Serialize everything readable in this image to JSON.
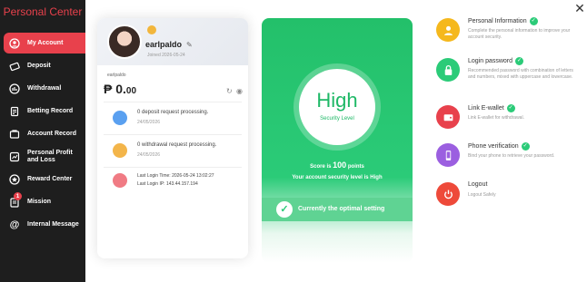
{
  "sidebar": {
    "title": "Personal Center",
    "items": [
      {
        "label": "My Account",
        "icon": "account-icon",
        "active": true
      },
      {
        "label": "Deposit",
        "icon": "deposit-icon"
      },
      {
        "label": "Withdrawal",
        "icon": "withdrawal-icon"
      },
      {
        "label": "Betting Record",
        "icon": "betting-record-icon"
      },
      {
        "label": "Account Record",
        "icon": "account-record-icon"
      },
      {
        "label": "Personal Profit and Loss",
        "icon": "profit-loss-icon"
      },
      {
        "label": "Reward Center",
        "icon": "reward-icon"
      },
      {
        "label": "Mission",
        "icon": "mission-icon",
        "badge": "1"
      },
      {
        "label": "Internal Message",
        "icon": "message-icon"
      }
    ],
    "accent_color": "#e8414c"
  },
  "account": {
    "username": "earlpaldo",
    "joined": "Joined 2026-05-24",
    "sub_username": "earlpaldo",
    "currency": "₱",
    "balance_main": "0.",
    "balance_cents": "00",
    "deposit_status": "0 deposit request processing.",
    "deposit_date": "24/05/2026",
    "withdraw_status": "0 withdrawal request processing.",
    "withdraw_date": "24/05/2026",
    "last_login_time": "Last Login Time:  2026-05-24 13:02:27",
    "last_login_ip": "Last Login IP:  143.44.157.194"
  },
  "security": {
    "level_word": "High",
    "level_caption": "Security Level",
    "score_prefix": "Score is",
    "score": "100",
    "score_suffix": "points",
    "description": "Your account security level is High",
    "status": "Currently the optimal setting",
    "color": "#2bcb78"
  },
  "options": [
    {
      "title": "Personal Information",
      "desc": "Complete the personal information to improve your account security.",
      "color": "#f5b81d",
      "icon": "user-icon"
    },
    {
      "title": "Login password",
      "desc": "Recommended password with combination of letters and numbers, mixed with uppercase and lowercase.",
      "color": "#2bcb78",
      "icon": "lock-icon"
    },
    {
      "title": "Link E-wallet",
      "desc": "Link E-wallet for withdrawal.",
      "color": "#e8414c",
      "icon": "wallet-icon"
    },
    {
      "title": "Phone verification",
      "desc": "Bind your phone to retrieve your password.",
      "color": "#9b5fe0",
      "icon": "phone-icon"
    },
    {
      "title": "Logout",
      "desc": "Logout Safely",
      "color": "#ee4a3a",
      "icon": "power-icon"
    }
  ]
}
